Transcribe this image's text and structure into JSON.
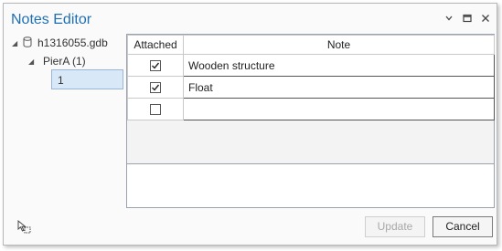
{
  "window": {
    "title": "Notes Editor",
    "controls": [
      "chevron-down-icon",
      "maximize-icon",
      "close-icon"
    ]
  },
  "tree": {
    "root": {
      "label": "h1316055.gdb",
      "icon": "database-icon",
      "expanded": true
    },
    "layer": {
      "label": "PierA (1)",
      "expanded": true
    },
    "feature": {
      "label": "1",
      "selected": true
    }
  },
  "table": {
    "columns": [
      "Attached",
      "Note"
    ],
    "rows": [
      {
        "attached": true,
        "note": "Wooden structure"
      },
      {
        "attached": true,
        "note": "Float"
      },
      {
        "attached": false,
        "note": ""
      }
    ]
  },
  "buttons": {
    "update": {
      "label": "Update",
      "enabled": false
    },
    "cancel": {
      "label": "Cancel",
      "enabled": true
    }
  }
}
